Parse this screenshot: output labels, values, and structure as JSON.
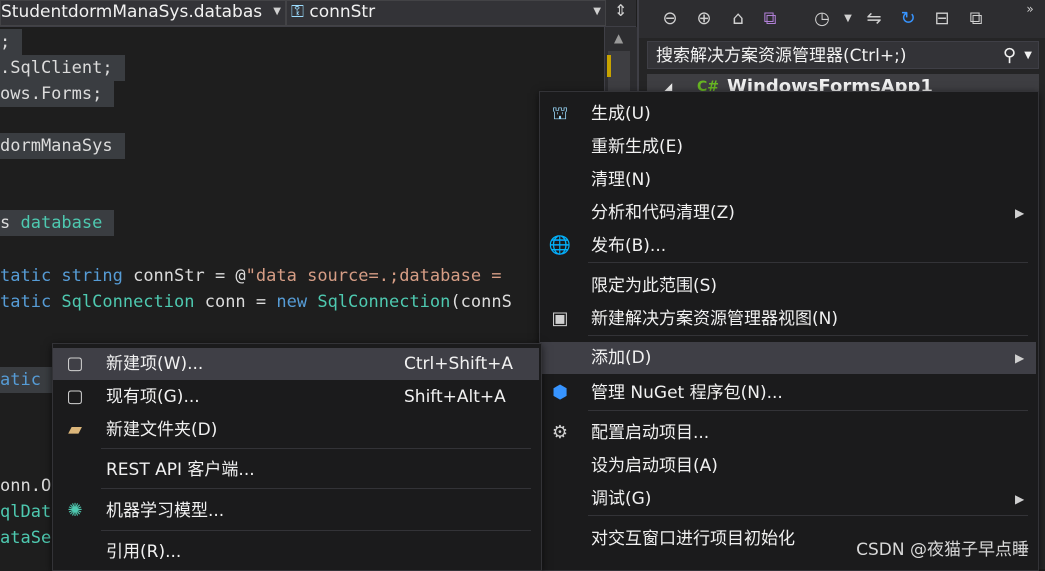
{
  "editor_nav": {
    "scope": "StudentdormManaSys.databas",
    "member": "connStr"
  },
  "code_lines": [
    {
      "parts": [
        {
          "t": ";",
          "c": "tx"
        }
      ]
    },
    {
      "parts": [
        {
          "t": ".SqlClient;",
          "c": "tx"
        }
      ]
    },
    {
      "parts": [
        {
          "t": "ows.Forms;",
          "c": "tx"
        }
      ]
    },
    {
      "parts": [
        {
          "t": "dormManaSys",
          "c": "tx"
        }
      ]
    },
    {
      "parts": [
        {
          "t": "s ",
          "c": "tx"
        },
        {
          "t": "database",
          "c": "ty"
        }
      ]
    },
    {
      "parts": [
        {
          "t": "tatic ",
          "c": "kw"
        },
        {
          "t": "string ",
          "c": "kw"
        },
        {
          "t": "connStr = @",
          "c": "tx"
        },
        {
          "t": "\"data source=.;database = ",
          "c": "str"
        }
      ]
    },
    {
      "parts": [
        {
          "t": "tatic ",
          "c": "kw"
        },
        {
          "t": "SqlConnection ",
          "c": "ty"
        },
        {
          "t": "conn = ",
          "c": "tx"
        },
        {
          "t": "new ",
          "c": "kw"
        },
        {
          "t": "SqlConnection",
          "c": "ty"
        },
        {
          "t": "(connS",
          "c": "tx"
        }
      ]
    },
    {
      "parts": [
        {
          "t": "atic",
          "c": "kw"
        }
      ]
    },
    {
      "parts": [
        {
          "t": "onn.O",
          "c": "tx"
        }
      ]
    },
    {
      "parts": [
        {
          "t": "qlDat",
          "c": "ty"
        }
      ]
    },
    {
      "parts": [
        {
          "t": "ataSe",
          "c": "ty"
        }
      ]
    }
  ],
  "solution_explorer": {
    "search_placeholder": "搜索解决方案资源管理器(Ctrl+;)",
    "project_name": "WindowsFormsApp1"
  },
  "main_menu": {
    "items": [
      {
        "label": "生成(U)",
        "icon": "build-icon"
      },
      {
        "label": "重新生成(E)"
      },
      {
        "label": "清理(N)"
      },
      {
        "label": "分析和代码清理(Z)",
        "submenu": true
      },
      {
        "label": "发布(B)...",
        "icon": "globe-icon"
      },
      {
        "label": "限定为此范围(S)"
      },
      {
        "label": "新建解决方案资源管理器视图(N)",
        "icon": "new-view-icon"
      },
      {
        "label": "添加(D)",
        "submenu": true,
        "selected": true
      },
      {
        "label": "管理 NuGet 程序包(N)...",
        "icon": "nuget-icon"
      },
      {
        "label": "配置启动项目...",
        "icon": "gear-icon"
      },
      {
        "label": "设为启动项目(A)"
      },
      {
        "label": "调试(G)",
        "submenu": true
      },
      {
        "label": "对交互窗口进行项目初始化"
      }
    ]
  },
  "add_submenu": {
    "items": [
      {
        "label": "新建项(W)...",
        "shortcut": "Ctrl+Shift+A",
        "icon": "new-item-icon",
        "selected": true
      },
      {
        "label": "现有项(G)...",
        "shortcut": "Shift+Alt+A",
        "icon": "existing-item-icon"
      },
      {
        "label": "新建文件夹(D)",
        "icon": "new-folder-icon"
      },
      {
        "label": "REST API 客户端..."
      },
      {
        "label": "机器学习模型...",
        "icon": "ml-model-icon"
      },
      {
        "label": "引用(R)..."
      }
    ]
  },
  "watermark": "CSDN @夜猫子早点睡"
}
